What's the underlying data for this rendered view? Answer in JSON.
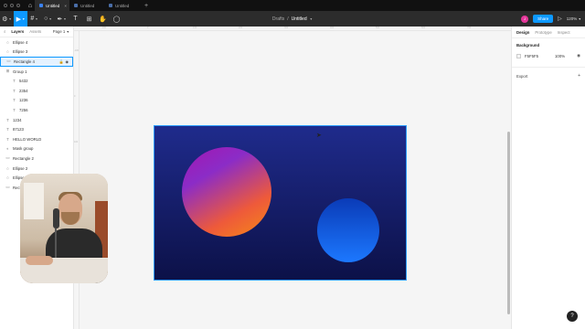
{
  "tabs": [
    {
      "label": "Untitled",
      "active": true
    },
    {
      "label": "Untitled",
      "active": false
    },
    {
      "label": "Untitled",
      "active": false
    }
  ],
  "toolbar": {
    "breadcrumb_folder": "Drafts",
    "breadcrumb_sep": "/",
    "file_name": "Untitled",
    "share_label": "Share",
    "zoom": "120%",
    "avatar_initial": "J"
  },
  "left_panel": {
    "tabs": {
      "layers": "Layers",
      "assets": "Assets",
      "page": "Page 1"
    },
    "layers": [
      {
        "name": "Ellipse 4",
        "icon": "○",
        "indent": false,
        "selected": false
      },
      {
        "name": "Ellipse 3",
        "icon": "○",
        "indent": false,
        "selected": false
      },
      {
        "name": "Rectangle 4",
        "icon": "▭",
        "indent": false,
        "selected": true
      },
      {
        "name": "Group 1",
        "icon": "⊞",
        "indent": false,
        "selected": false
      },
      {
        "name": "5432",
        "icon": "T",
        "indent": true,
        "selected": false
      },
      {
        "name": "2354",
        "icon": "T",
        "indent": true,
        "selected": false
      },
      {
        "name": "1236",
        "icon": "T",
        "indent": true,
        "selected": false
      },
      {
        "name": "7256",
        "icon": "T",
        "indent": true,
        "selected": false
      },
      {
        "name": "1234",
        "icon": "T",
        "indent": false,
        "selected": false
      },
      {
        "name": "87123",
        "icon": "T",
        "indent": false,
        "selected": false
      },
      {
        "name": "HELLO WORLD",
        "icon": "T",
        "indent": false,
        "selected": false
      },
      {
        "name": "Mask group",
        "icon": "◐",
        "indent": false,
        "selected": false
      },
      {
        "name": "Rectangle 2",
        "icon": "▭",
        "indent": false,
        "selected": false
      },
      {
        "name": "Ellipse 2",
        "icon": "○",
        "indent": false,
        "selected": false
      },
      {
        "name": "Ellipse 1",
        "icon": "○",
        "indent": false,
        "selected": false
      },
      {
        "name": "Rectangle 1",
        "icon": "▭",
        "indent": false,
        "selected": false
      }
    ]
  },
  "right_panel": {
    "tabs": {
      "design": "Design",
      "prototype": "Prototype",
      "inspect": "Inspect"
    },
    "background_label": "Background",
    "background_hex": "F5F5F5",
    "background_opacity": "100%",
    "export_label": "Export"
  },
  "colors": {
    "accent": "#0d99ff",
    "frame_top": "#1f2b8c",
    "frame_bottom": "#0c1148",
    "avatar": "#e5379b"
  },
  "help_label": "?"
}
